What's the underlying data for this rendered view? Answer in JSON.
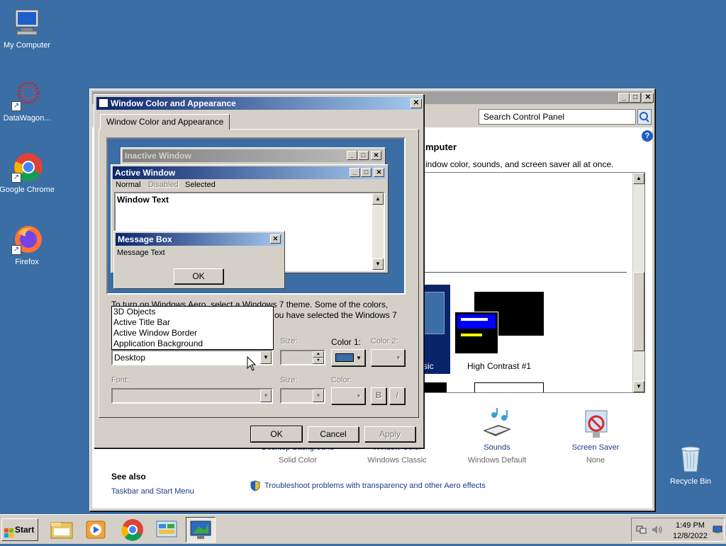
{
  "desktop": {
    "icons": [
      {
        "label": "My Computer",
        "icon": "computer-icon"
      },
      {
        "label": "DataWagon...",
        "icon": "datawagon-icon"
      },
      {
        "label": "Google Chrome",
        "icon": "chrome-icon"
      },
      {
        "label": "Firefox",
        "icon": "firefox-icon"
      },
      {
        "label": "Recycle Bin",
        "icon": "recycle-bin-icon"
      }
    ]
  },
  "control_panel": {
    "search_placeholder": "Search Control Panel",
    "heading_partial": "mputer",
    "subtitle_partial": "indow color, sounds, and screen saver all at once.",
    "theme_label_partial": "sic",
    "theme_name": "High Contrast #1",
    "bottom_items": [
      {
        "label": "Desktop Background",
        "value": "Solid Color"
      },
      {
        "label": "Window Color",
        "value": "Windows Classic"
      },
      {
        "label": "Sounds",
        "value": "Windows Default"
      },
      {
        "label": "Screen Saver",
        "value": "None"
      }
    ],
    "see_also_title": "See also",
    "see_also_link": "Taskbar and Start Menu",
    "troubleshoot_link": "Troubleshoot problems with transparency and other Aero effects"
  },
  "dialog": {
    "title": "Window Color and Appearance",
    "tab": "Window Color and Appearance",
    "preview": {
      "inactive_title": "Inactive Window",
      "active_title": "Active Window",
      "menu": [
        "Normal",
        "Disabled",
        "Selected"
      ],
      "window_text": "Window Text",
      "message_title": "Message Box",
      "message_text": "Message Text",
      "message_ok": "OK"
    },
    "info_line1": "To turn on Windows Aero, select a Windows 7 theme.  Some of the colors,",
    "info_line2": "ou have selected the Windows 7",
    "item_list": [
      "3D Objects",
      "Active Title Bar",
      "Active Window Border",
      "Application Background"
    ],
    "item_selected": "Desktop",
    "labels": {
      "size": "Size:",
      "color1": "Color 1:",
      "color2": "Color 2:",
      "font": "Font:",
      "size2": "Size:",
      "color": "Color:",
      "bold": "B",
      "italic": "I"
    },
    "color1_value": "#3a6ea5",
    "buttons": {
      "ok": "OK",
      "cancel": "Cancel",
      "apply": "Apply"
    }
  },
  "taskbar": {
    "start_label": "Start",
    "time": "1:49 PM",
    "date": "12/8/2022"
  }
}
